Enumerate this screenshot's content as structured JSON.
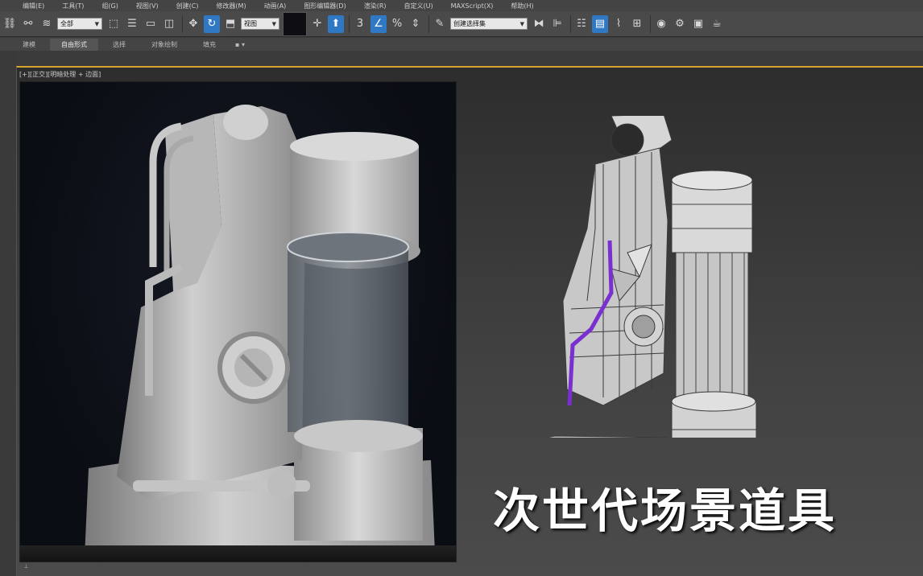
{
  "menu": {
    "items": [
      "编辑(E)",
      "工具(T)",
      "组(G)",
      "视图(V)",
      "创建(C)",
      "修改器(M)",
      "动画(A)",
      "图形编辑器(D)",
      "渲染(R)",
      "自定义(U)",
      "MAXScript(X)",
      "帮助(H)"
    ]
  },
  "toolbar": {
    "selection_filter": "全部",
    "reference_coord": "视图",
    "named_selection": "创建选择集"
  },
  "ribbon": {
    "tabs": [
      "建模",
      "自由形式",
      "选择",
      "对象绘制",
      "填充"
    ],
    "active_tab": "自由形式"
  },
  "viewport": {
    "label": "[+][正交][明暗处理 + 边面]"
  },
  "caption": "次世代场景道具",
  "colors": {
    "active_border": "#d4a531",
    "highlight_purple": "#7a2fd0",
    "highlight_yellow": "#d7f56a",
    "active_button": "#2f78c4"
  }
}
